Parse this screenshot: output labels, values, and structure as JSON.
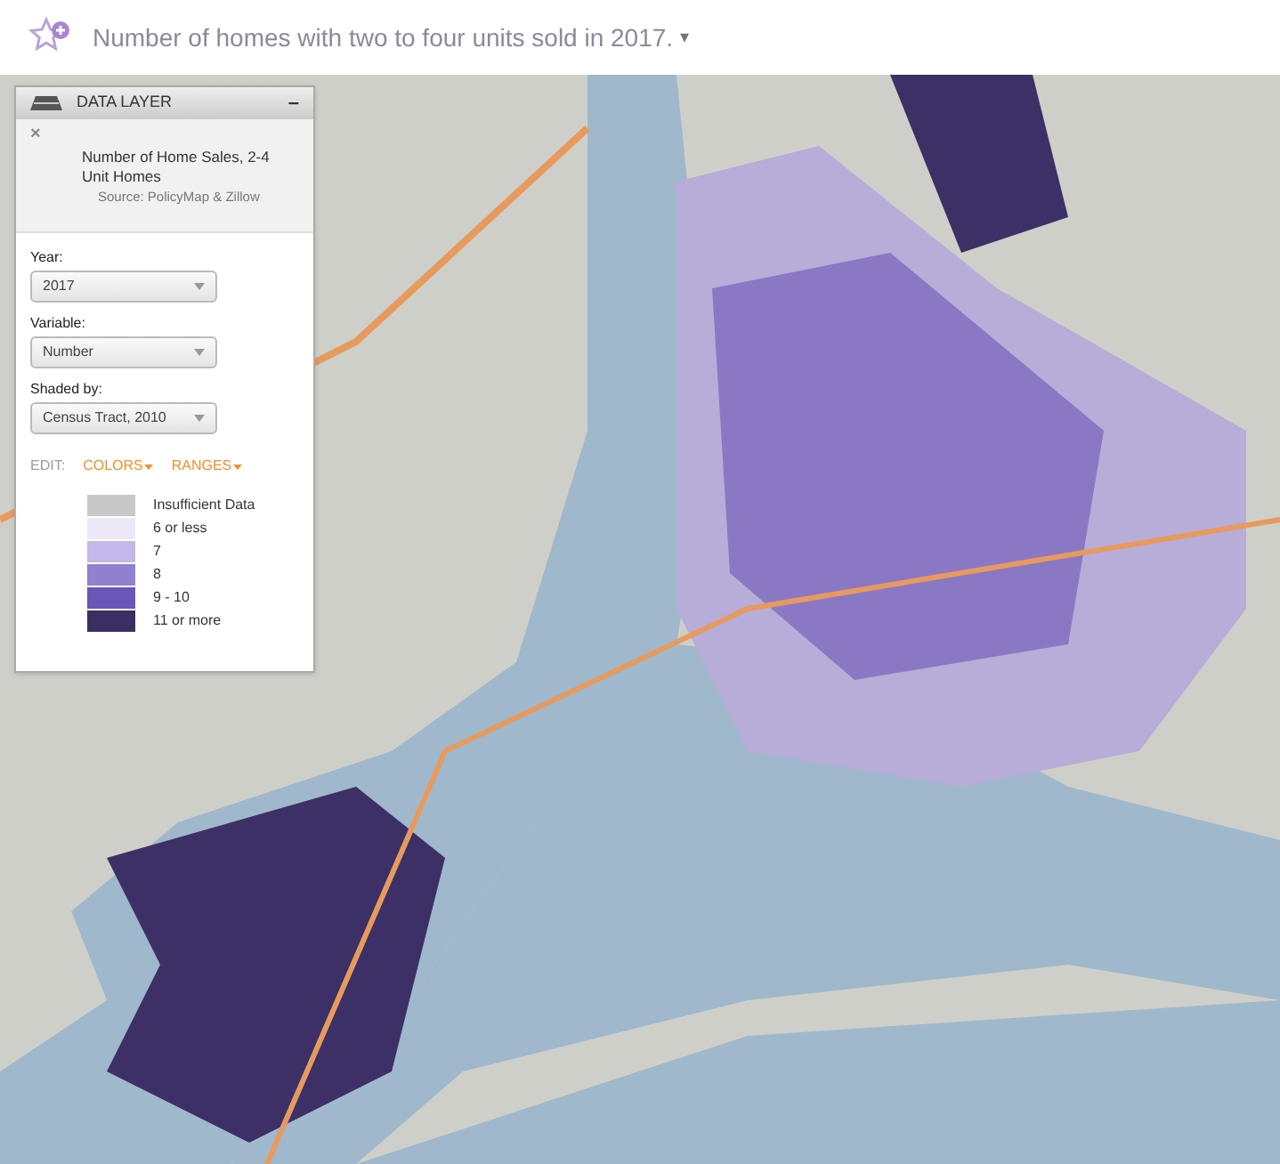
{
  "header": {
    "title": "Number of homes with two to four units sold in 2017.",
    "caret": "▾"
  },
  "panel": {
    "title": "DATA LAYER",
    "collapse": "–",
    "close": "×",
    "layer_name": "Number of Home Sales, 2-4 Unit Homes",
    "source": "Source: PolicyMap & Zillow",
    "fields": [
      {
        "label": "Year:",
        "value": "2017"
      },
      {
        "label": "Variable:",
        "value": "Number"
      },
      {
        "label": "Shaded by:",
        "value": "Census Tract, 2010"
      }
    ],
    "edit_label": "EDIT:",
    "edit_links": [
      "COLORS",
      "RANGES"
    ],
    "legend": [
      {
        "label": "Insufficient Data",
        "color": "#c8c8c8"
      },
      {
        "label": "6 or less",
        "color": "#ece8f8"
      },
      {
        "label": "7",
        "color": "#c4b8e8"
      },
      {
        "label": "8",
        "color": "#9080d0"
      },
      {
        "label": "9 - 10",
        "color": "#6a55b8"
      },
      {
        "label": "11 or more",
        "color": "#3b2f62"
      }
    ]
  }
}
